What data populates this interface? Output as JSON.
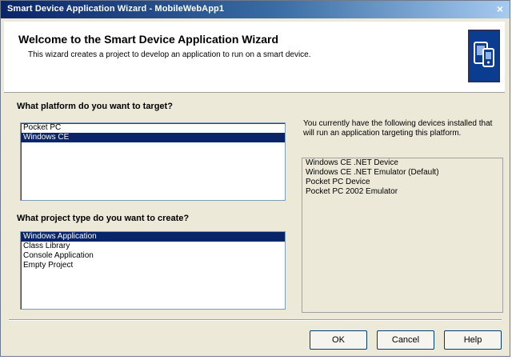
{
  "window": {
    "title": "Smart Device Application Wizard - MobileWebApp1",
    "close_glyph": "×"
  },
  "banner": {
    "title": "Welcome to the Smart Device Application Wizard",
    "description": "This wizard creates a project to develop an application to run on a smart device.",
    "icon": "smart-device-icon"
  },
  "platform": {
    "label": "What platform do you want to target?",
    "items": [
      "Pocket PC",
      "Windows CE"
    ],
    "selected_index": 1
  },
  "project_type": {
    "label": "What project type do you want to create?",
    "items": [
      "Windows Application",
      "Class Library",
      "Console Application",
      "Empty Project"
    ],
    "selected_index": 0
  },
  "devices": {
    "info": "You currently have the following devices installed that will run an application targeting this platform.",
    "items": [
      "Windows CE .NET Device",
      "Windows CE .NET Emulator (Default)",
      "Pocket PC Device",
      "Pocket PC 2002 Emulator"
    ]
  },
  "buttons": {
    "ok": "OK",
    "cancel": "Cancel",
    "help": "Help"
  },
  "colors": {
    "titlebar": "#0a246a",
    "selection": "#0a246a",
    "dialog_bg": "#ece9d8"
  }
}
